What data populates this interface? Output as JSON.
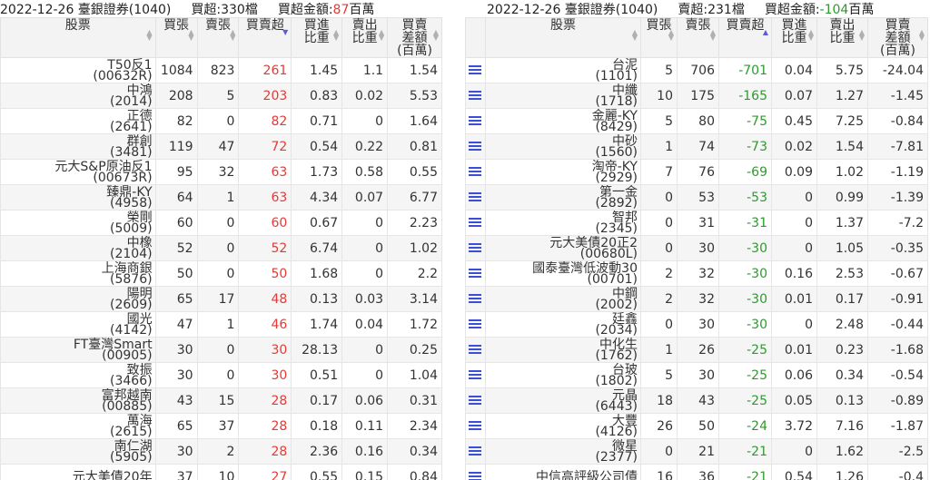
{
  "left": {
    "title": {
      "date_broker": "2022-12-26 臺銀證券(1040)",
      "count": "買超:330檔",
      "amount_label": "買超金額:",
      "amount_value": "87",
      "amount_unit": "百萬"
    },
    "headers": [
      "股票",
      "買張",
      "賣張",
      "買賣超",
      "買進\n比重",
      "賣出\n比重",
      "買賣\n差額\n(百萬)"
    ],
    "rows": [
      {
        "name": "T50反1",
        "code": "(00632R)",
        "buy": "1084",
        "sell": "823",
        "net": "261",
        "bw": "1.45",
        "sw": "1.1",
        "diff": "1.54"
      },
      {
        "name": "中鴻",
        "code": "(2014)",
        "buy": "208",
        "sell": "5",
        "net": "203",
        "bw": "0.83",
        "sw": "0.02",
        "diff": "5.53"
      },
      {
        "name": "正德",
        "code": "(2641)",
        "buy": "82",
        "sell": "0",
        "net": "82",
        "bw": "0.71",
        "sw": "0",
        "diff": "1.64"
      },
      {
        "name": "群創",
        "code": "(3481)",
        "buy": "119",
        "sell": "47",
        "net": "72",
        "bw": "0.54",
        "sw": "0.22",
        "diff": "0.81"
      },
      {
        "name": "元大S&P原油反1",
        "code": "(00673R)",
        "buy": "95",
        "sell": "32",
        "net": "63",
        "bw": "1.73",
        "sw": "0.58",
        "diff": "0.55"
      },
      {
        "name": "臻鼎-KY",
        "code": "(4958)",
        "buy": "64",
        "sell": "1",
        "net": "63",
        "bw": "4.34",
        "sw": "0.07",
        "diff": "6.77"
      },
      {
        "name": "榮剛",
        "code": "(5009)",
        "buy": "60",
        "sell": "0",
        "net": "60",
        "bw": "0.67",
        "sw": "0",
        "diff": "2.23"
      },
      {
        "name": "中橡",
        "code": "(2104)",
        "buy": "52",
        "sell": "0",
        "net": "52",
        "bw": "6.74",
        "sw": "0",
        "diff": "1.02"
      },
      {
        "name": "上海商銀",
        "code": "(5876)",
        "buy": "50",
        "sell": "0",
        "net": "50",
        "bw": "1.68",
        "sw": "0",
        "diff": "2.2"
      },
      {
        "name": "陽明",
        "code": "(2609)",
        "buy": "65",
        "sell": "17",
        "net": "48",
        "bw": "0.13",
        "sw": "0.03",
        "diff": "3.14"
      },
      {
        "name": "國光",
        "code": "(4142)",
        "buy": "47",
        "sell": "1",
        "net": "46",
        "bw": "1.74",
        "sw": "0.04",
        "diff": "1.72"
      },
      {
        "name": "FT臺灣Smart",
        "code": "(00905)",
        "buy": "30",
        "sell": "0",
        "net": "30",
        "bw": "28.13",
        "sw": "0",
        "diff": "0.25"
      },
      {
        "name": "致振",
        "code": "(3466)",
        "buy": "30",
        "sell": "0",
        "net": "30",
        "bw": "0.51",
        "sw": "0",
        "diff": "1.04"
      },
      {
        "name": "富邦越南",
        "code": "(00885)",
        "buy": "43",
        "sell": "15",
        "net": "28",
        "bw": "0.17",
        "sw": "0.06",
        "diff": "0.31"
      },
      {
        "name": "萬海",
        "code": "(2615)",
        "buy": "65",
        "sell": "37",
        "net": "28",
        "bw": "0.18",
        "sw": "0.11",
        "diff": "2.34"
      },
      {
        "name": "南仁湖",
        "code": "(5905)",
        "buy": "30",
        "sell": "2",
        "net": "28",
        "bw": "2.36",
        "sw": "0.16",
        "diff": "0.34"
      },
      {
        "name": "元大美債20年",
        "code": "",
        "buy": "37",
        "sell": "10",
        "net": "27",
        "bw": "0.55",
        "sw": "0.15",
        "diff": "0.84"
      }
    ]
  },
  "right": {
    "title": {
      "date_broker": "2022-12-26 臺銀證券(1040)",
      "count": "賣超:231檔",
      "amount_label": "買超金額:",
      "amount_value": "-104",
      "amount_unit": "百萬"
    },
    "headers": [
      "",
      "股票",
      "買張",
      "賣張",
      "買賣超",
      "買進\n比重",
      "賣出\n比重",
      "買賣\n差額\n(百萬)"
    ],
    "row_icon": "list-icon",
    "rows": [
      {
        "name": "台泥",
        "code": "(1101)",
        "buy": "5",
        "sell": "706",
        "net": "-701",
        "bw": "0.04",
        "sw": "5.75",
        "diff": "-24.04"
      },
      {
        "name": "中纖",
        "code": "(1718)",
        "buy": "10",
        "sell": "175",
        "net": "-165",
        "bw": "0.07",
        "sw": "1.27",
        "diff": "-1.45"
      },
      {
        "name": "金麗-KY",
        "code": "(8429)",
        "buy": "5",
        "sell": "80",
        "net": "-75",
        "bw": "0.45",
        "sw": "7.25",
        "diff": "-0.84"
      },
      {
        "name": "中砂",
        "code": "(1560)",
        "buy": "1",
        "sell": "74",
        "net": "-73",
        "bw": "0.02",
        "sw": "1.54",
        "diff": "-7.81"
      },
      {
        "name": "淘帝-KY",
        "code": "(2929)",
        "buy": "7",
        "sell": "76",
        "net": "-69",
        "bw": "0.09",
        "sw": "1.02",
        "diff": "-1.19"
      },
      {
        "name": "第一金",
        "code": "(2892)",
        "buy": "0",
        "sell": "53",
        "net": "-53",
        "bw": "0",
        "sw": "0.99",
        "diff": "-1.39"
      },
      {
        "name": "智邦",
        "code": "(2345)",
        "buy": "0",
        "sell": "31",
        "net": "-31",
        "bw": "0",
        "sw": "1.37",
        "diff": "-7.2"
      },
      {
        "name": "元大美債20正2",
        "code": "(00680L)",
        "buy": "0",
        "sell": "30",
        "net": "-30",
        "bw": "0",
        "sw": "1.05",
        "diff": "-0.35"
      },
      {
        "name": "國泰臺灣低波動30",
        "code": "(00701)",
        "buy": "2",
        "sell": "32",
        "net": "-30",
        "bw": "0.16",
        "sw": "2.53",
        "diff": "-0.67"
      },
      {
        "name": "中鋼",
        "code": "(2002)",
        "buy": "2",
        "sell": "32",
        "net": "-30",
        "bw": "0.01",
        "sw": "0.17",
        "diff": "-0.91"
      },
      {
        "name": "廷鑫",
        "code": "(2034)",
        "buy": "0",
        "sell": "30",
        "net": "-30",
        "bw": "0",
        "sw": "2.48",
        "diff": "-0.44"
      },
      {
        "name": "中化生",
        "code": "(1762)",
        "buy": "1",
        "sell": "26",
        "net": "-25",
        "bw": "0.01",
        "sw": "0.23",
        "diff": "-1.68"
      },
      {
        "name": "台玻",
        "code": "(1802)",
        "buy": "5",
        "sell": "30",
        "net": "-25",
        "bw": "0.06",
        "sw": "0.34",
        "diff": "-0.54"
      },
      {
        "name": "元晶",
        "code": "(6443)",
        "buy": "18",
        "sell": "43",
        "net": "-25",
        "bw": "0.05",
        "sw": "0.13",
        "diff": "-0.89"
      },
      {
        "name": "大豐",
        "code": "(4126)",
        "buy": "26",
        "sell": "50",
        "net": "-24",
        "bw": "3.72",
        "sw": "7.16",
        "diff": "-1.87"
      },
      {
        "name": "微星",
        "code": "(2377)",
        "buy": "0",
        "sell": "21",
        "net": "-21",
        "bw": "0",
        "sw": "1.62",
        "diff": "-2.5"
      },
      {
        "name": "中信高評級公司債",
        "code": "",
        "buy": "16",
        "sell": "36",
        "net": "-21",
        "bw": "0.54",
        "sw": "1.26",
        "diff": "-0.4"
      }
    ]
  }
}
